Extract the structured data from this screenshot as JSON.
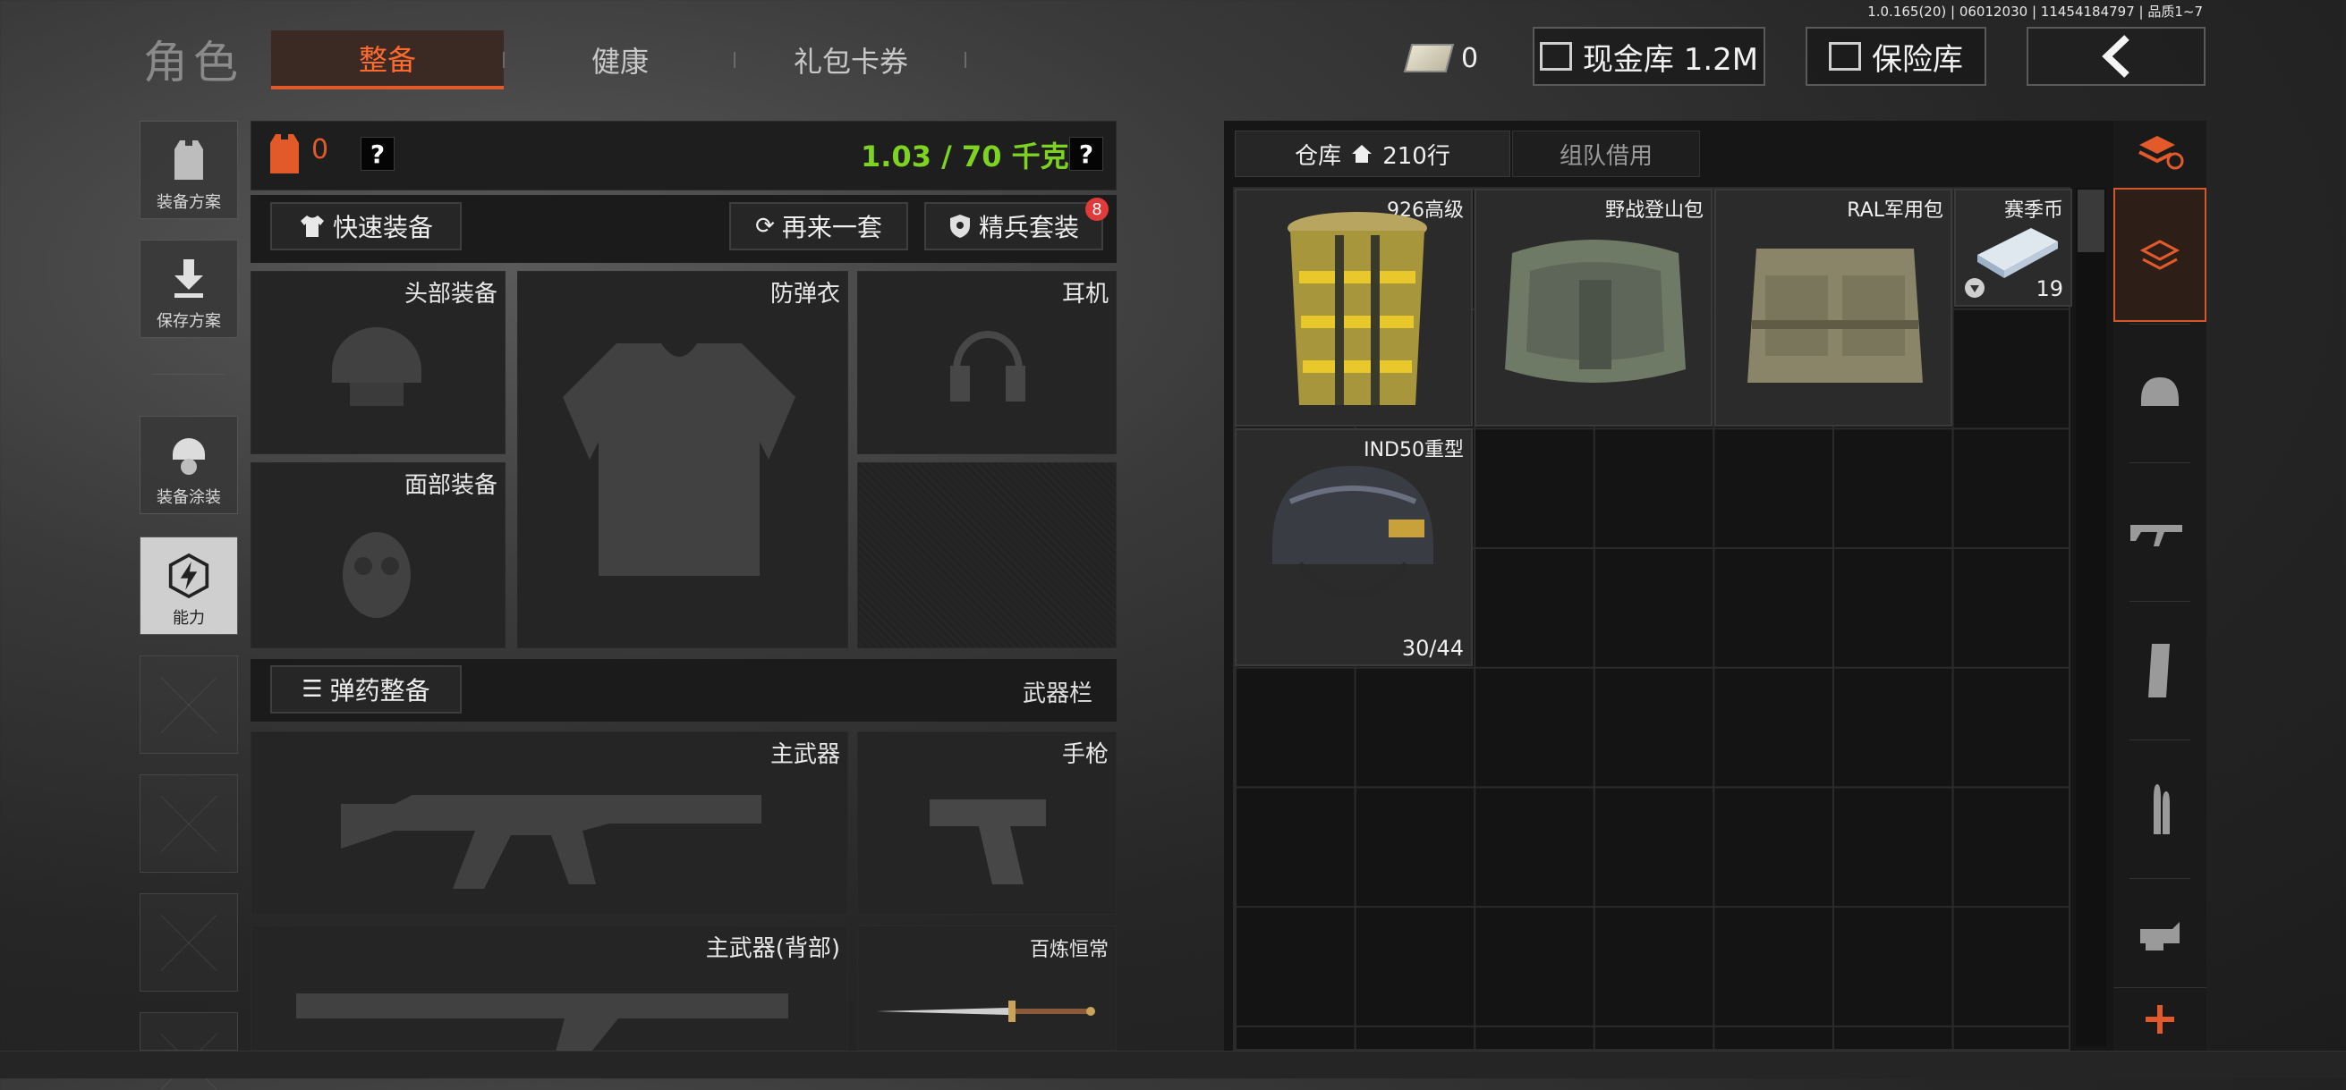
{
  "version": "1.0.165(20) | 06012030 | 11454184797 | 品质1~7",
  "header": {
    "title": "角色",
    "tabs": [
      {
        "label": "整备",
        "active": true
      },
      {
        "label": "健康",
        "active": false
      },
      {
        "label": "礼包卡券",
        "active": false
      }
    ],
    "money_value": "0",
    "cash_vault": "现金库 1.2M",
    "safe_vault": "保险库",
    "back_icon": "chevron-left-icon"
  },
  "sidebar": {
    "items": [
      {
        "label": "装备方案",
        "icon": "vest-icon"
      },
      {
        "label": "保存方案",
        "icon": "download-icon"
      },
      {
        "label": "装备涂装",
        "icon": "helmet-paint-icon"
      },
      {
        "label": "能力",
        "icon": "lightning-icon",
        "active": true
      }
    ]
  },
  "loadout": {
    "armor_count": "0",
    "help": "?",
    "weight": "1.03 / 70 千克",
    "weight_color": "#7ed321",
    "quick_equip": "快速装备",
    "another_set": "再来一套",
    "elite_set": "精兵套装",
    "elite_badge": "8",
    "slots": {
      "head": "头部装备",
      "armor": "防弹衣",
      "headset": "耳机",
      "face": "面部装备",
      "ammo": "弹药整备",
      "weapon_bar": "武器栏",
      "primary": "主武器",
      "pistol": "手枪",
      "primary_back": "主武器(背部)",
      "melee": "百炼恒常"
    }
  },
  "warehouse": {
    "tab_label": "仓库",
    "tab_rows": "210行",
    "tab_team": "组队借用",
    "items": [
      {
        "name": "926高级",
        "count": ""
      },
      {
        "name": "野战登山包",
        "count": ""
      },
      {
        "name": "RAL军用包",
        "count": ""
      },
      {
        "name": "赛季币",
        "count": "19"
      },
      {
        "name": "IND50重型",
        "count": "30/44"
      }
    ]
  },
  "categories": [
    "stack-refresh-icon",
    "backpack-icon",
    "helmet-icon",
    "rifle-icon",
    "magazine-icon",
    "bullet-icon",
    "scope-icon",
    "add-icon"
  ],
  "accent": "#e25a2a"
}
